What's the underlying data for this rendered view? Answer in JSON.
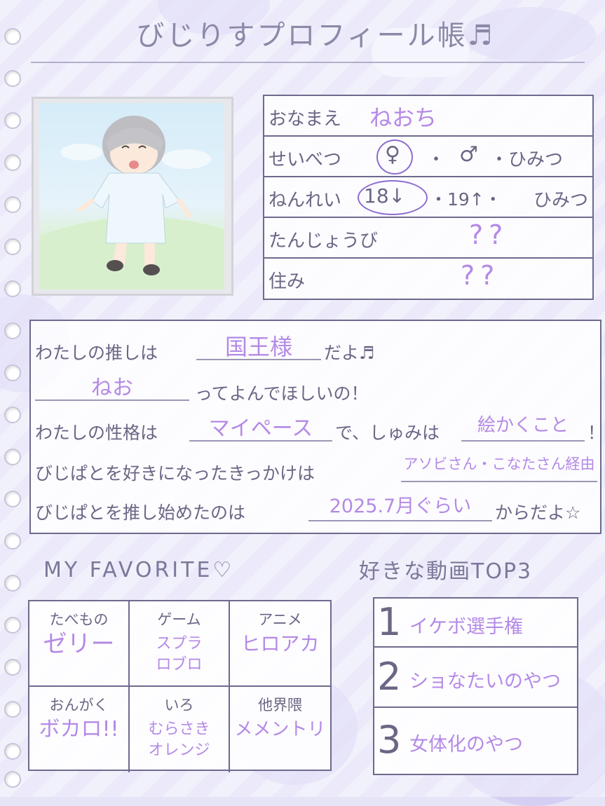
{
  "title": "びじりすプロフィール帳♬",
  "profile": {
    "name_label": "おなまえ",
    "name_value": "ねおち",
    "gender_label": "せいべつ",
    "gender_options": [
      "♀",
      "・",
      "♂",
      "・ひみつ"
    ],
    "age_label": "ねんれい",
    "age_options": [
      "18↓",
      "・19↑・",
      "ひみつ"
    ],
    "birthday_label": "たんじょうび",
    "birthday_value": "??",
    "residence_label": "住み",
    "residence_value": "??"
  },
  "message": {
    "line1_prefix": "わたしの推しは",
    "line1_fill": "国王様",
    "line1_suffix": "だよ♬",
    "line2_fill": "ねお",
    "line2_suffix": "ってよんでほしいの！",
    "line3_prefix": "わたしの性格は",
    "line3_fill1": "マイペース",
    "line3_middle": "で、しゅみは",
    "line3_fill2": "絵かくこと",
    "line3_suffix": "！",
    "line4_prefix": "びじぱとを好きになったきっかけは",
    "line4_fill": "アソビさん・こなたさん経由",
    "line5_prefix": "びじぱとを推し始めたのは",
    "line5_fill": "2025.7月ぐらい",
    "line5_suffix": "からだよ☆"
  },
  "favorites": {
    "heading": "MY FAVORITE♡",
    "cells": [
      {
        "label": "たべもの",
        "value": "ゼリー"
      },
      {
        "label": "ゲーム",
        "value": "スプラ\nロブロ"
      },
      {
        "label": "アニメ",
        "value": "ヒロアカ"
      },
      {
        "label": "おんがく",
        "value": "ボカロ!!"
      },
      {
        "label": "いろ",
        "value": "むらさき\nオレンジ"
      },
      {
        "label": "他界隈",
        "value": "メメントリ"
      }
    ]
  },
  "top3": {
    "heading": "好きな動画TOP3",
    "items": [
      {
        "num": "1",
        "value": "イケボ選手権"
      },
      {
        "num": "2",
        "value": "ショなたいのやつ"
      },
      {
        "num": "3",
        "value": "女体化のやつ"
      }
    ]
  },
  "colors": {
    "background": "#e6e4f7",
    "ink": "#6a6785",
    "handwriting": "#b48ae6",
    "lines": "#6d6a8e"
  }
}
